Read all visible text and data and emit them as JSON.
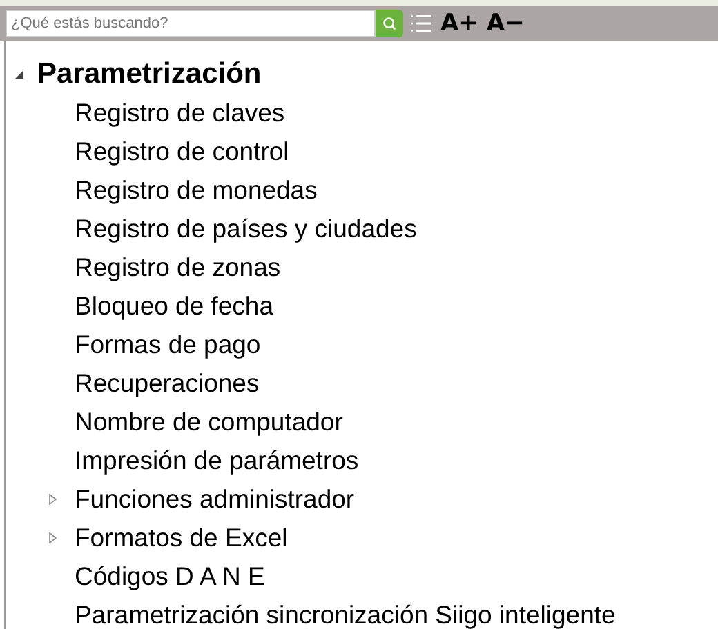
{
  "toolbar": {
    "search": {
      "placeholder": "¿Qué estás buscando?"
    },
    "font_buttons": [
      "A+",
      "A−"
    ]
  },
  "tree": [
    {
      "label": "Parametrización",
      "kind": "folder",
      "expanded": true,
      "children": [
        {
          "label": "Registro de claves",
          "kind": "leaf"
        },
        {
          "label": "Registro de control",
          "kind": "leaf"
        },
        {
          "label": "Registro de monedas",
          "kind": "leaf"
        },
        {
          "label": "Registro de países y ciudades",
          "kind": "leaf"
        },
        {
          "label": "Registro de zonas",
          "kind": "leaf"
        },
        {
          "label": "Bloqueo de fecha",
          "kind": "leaf"
        },
        {
          "label": "Formas de pago",
          "kind": "leaf"
        },
        {
          "label": "Recuperaciones",
          "kind": "leaf"
        },
        {
          "label": "Nombre de computador",
          "kind": "leaf"
        },
        {
          "label": "Impresión de parámetros",
          "kind": "leaf"
        },
        {
          "label": "Funciones administrador",
          "kind": "folder",
          "expanded": false
        },
        {
          "label": "Formatos de Excel",
          "kind": "folder",
          "expanded": false
        },
        {
          "label": "Códigos D A N E",
          "kind": "leaf"
        },
        {
          "label": "Parametrización sincronización Siigo inteligente",
          "kind": "leaf"
        }
      ]
    }
  ]
}
